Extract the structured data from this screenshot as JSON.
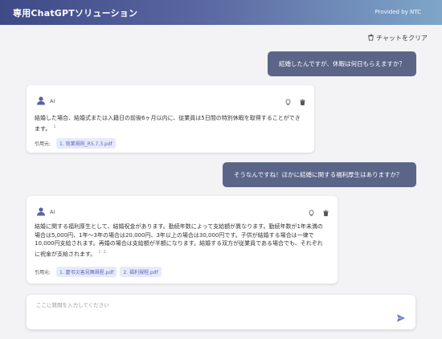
{
  "header": {
    "title": "専用ChatGPTソリューション",
    "provided": "Provided by NTC"
  },
  "toolbar": {
    "clear_label": "チャットをクリア"
  },
  "messages": [
    {
      "role": "user",
      "text": "結婚したんですが、休暇は何日もらえますか？"
    },
    {
      "role": "ai",
      "label": "AI",
      "text": "結婚した場合、結婚式または入籍日の前後6ヶ月以内に、従業員は5日間の特別休暇を取得することができます。",
      "footnotes": [
        "1"
      ],
      "refs_label": "引用元:",
      "refs": [
        "1. 就業規則_R5.7.3.pdf"
      ]
    },
    {
      "role": "user",
      "text": "そうなんですね！ほかに結婚に関する福利厚生はありますか？"
    },
    {
      "role": "ai",
      "label": "AI",
      "text": "結婚に関する福利厚生として、結婚祝金があります。勤続年数によって支給額が異なります。勤続年数が1年未満の場合は5,000円、1年〜3年の場合は20,000円、3年以上の場合は30,000円です。子供が結婚する場合は一律で10,000円支給されます。再婚の場合は支給額が半額になります。結婚する双方が従業員である場合でも、それぞれに祝金が支給されます。",
      "footnotes": [
        "1",
        "2"
      ],
      "refs_label": "引用元:",
      "refs": [
        "1. 慶弔災害見舞規程.pdf",
        "2. 福利規程.pdf"
      ]
    }
  ],
  "input": {
    "placeholder": "ここに質問を入力してください",
    "value": ""
  },
  "colors": {
    "header_start": "#3e4a86",
    "header_end": "#7ea6c9",
    "user_bubble": "#5a6588",
    "accent": "#5868b8"
  },
  "icons": {
    "clear": "trash-icon",
    "avatar": "user-avatar-icon",
    "hint": "lightbulb-icon",
    "delete": "trash-icon",
    "send": "send-icon"
  }
}
